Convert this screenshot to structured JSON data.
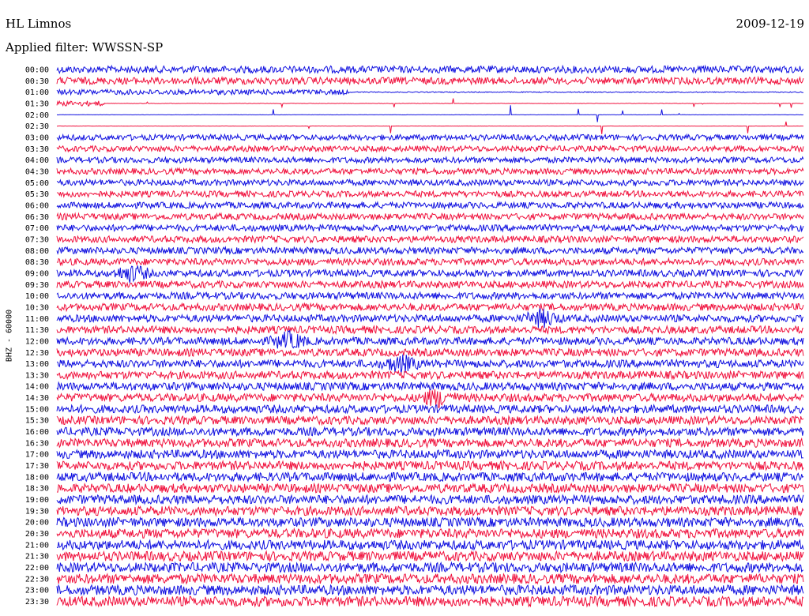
{
  "header": {
    "station": "HL Limnos",
    "date": "2009-12-19",
    "filter": "Applied filter: WWSSN-SP"
  },
  "chart_data": {
    "type": "line",
    "title": "HL Limnos",
    "subtitle": "Applied filter: WWSSN-SP",
    "date": "2009-12-19",
    "ylabel": "BHZ - 60000",
    "ytick_labels": [
      "00:00",
      "00:30",
      "01:00",
      "01:30",
      "02:00",
      "02:30",
      "03:00",
      "03:30",
      "04:00",
      "04:30",
      "05:00",
      "05:30",
      "06:00",
      "06:30",
      "07:00",
      "07:30",
      "08:00",
      "08:30",
      "09:00",
      "09:30",
      "10:00",
      "10:30",
      "11:00",
      "11:30",
      "12:00",
      "12:30",
      "13:00",
      "13:30",
      "14:00",
      "14:30",
      "15:00",
      "15:30",
      "16:00",
      "16:30",
      "17:00",
      "17:30",
      "18:00",
      "18:30",
      "19:00",
      "19:30",
      "20:00",
      "20:30",
      "21:00",
      "21:30",
      "22:00",
      "22:30",
      "23:00",
      "23:30"
    ],
    "trace_colors": [
      "#1010e0",
      "#f0103c"
    ],
    "data_gap": {
      "start": "01:30",
      "end": "03:00"
    },
    "events": [
      {
        "time": "09:00",
        "position": 0.1
      },
      {
        "time": "11:00",
        "position": 0.65
      },
      {
        "time": "12:00",
        "position": 0.31
      },
      {
        "time": "13:00",
        "position": 0.46
      },
      {
        "time": "14:30",
        "position": 0.51
      }
    ],
    "grid": false
  }
}
